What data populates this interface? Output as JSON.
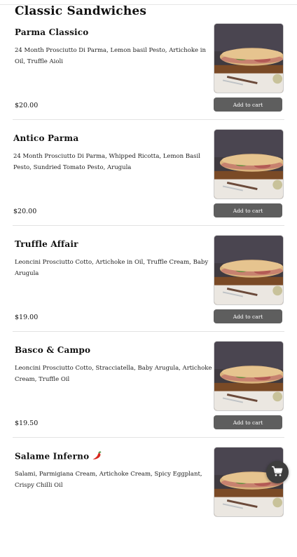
{
  "section": {
    "title": "Classic Sandwiches"
  },
  "items": [
    {
      "name": "Parma Classico",
      "description": "24 Month Prosciutto Di Parma, Lemon basil Pesto, Artichoke in Oil, Truffle Aioli",
      "price": "$20.00",
      "button_label": "Add to cart",
      "image_icon": "sandwich-photo"
    },
    {
      "name": "Antico Parma",
      "description": "24 Month Prosciutto Di Parma, Whipped Ricotta, Lemon Basil Pesto, Sundried Tomato Pesto, Arugula",
      "price": "$20.00",
      "button_label": "Add to cart",
      "image_icon": "sandwich-photo"
    },
    {
      "name": "Truffle Affair",
      "description": "Leoncini Prosciutto Cotto, Artichoke in Oil, Truffle Cream, Baby Arugula",
      "price": "$19.00",
      "button_label": "Add to cart",
      "image_icon": "sandwich-photo"
    },
    {
      "name": "Basco & Campo",
      "description": "Leoncini Prosciutto Cotto, Stracciatella, Baby Arugula, Artichoke Cream, Truffle Oil",
      "price": "$19.50",
      "button_label": "Add to cart",
      "image_icon": "sandwich-photo"
    },
    {
      "name": "Salame Inferno",
      "name_icon": "chili-pepper-icon",
      "description": "Salami, Parmigiana Cream, Artichoke Cream, Spicy Eggplant, Crispy Chilli Oil",
      "image_icon": "sandwich-photo"
    }
  ],
  "floating_cart": {
    "icon": "shopping-cart-icon"
  },
  "colors": {
    "button_bg": "#5e5e5e",
    "fab_bg": "#3d3d3d",
    "divider": "#e3e3e3"
  }
}
